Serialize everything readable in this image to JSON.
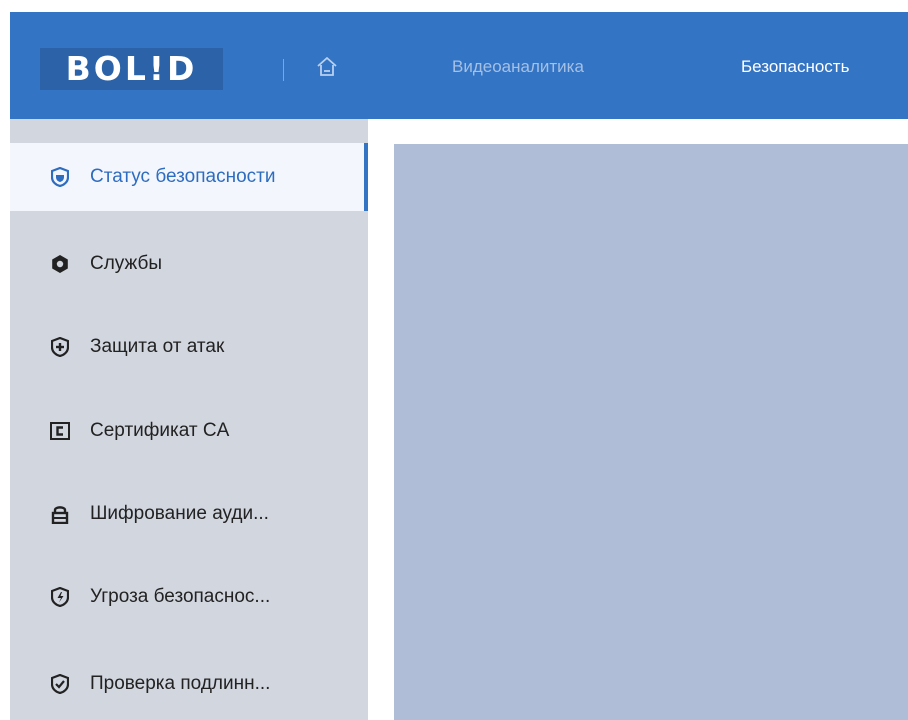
{
  "header": {
    "logo_text": "BOL!D",
    "home_icon": "home-icon",
    "nav": [
      {
        "label": "Видеоаналитика",
        "active": false
      },
      {
        "label": "Безопасность",
        "active": true
      }
    ]
  },
  "sidebar": {
    "items": [
      {
        "label": "Статус безопасности",
        "icon": "shield-icon",
        "active": true
      },
      {
        "label": "Службы",
        "icon": "gear-icon",
        "active": false
      },
      {
        "label": "Защита от атак",
        "icon": "shield-plus-icon",
        "active": false
      },
      {
        "label": "Сертификат CA",
        "icon": "certificate-icon",
        "active": false
      },
      {
        "label": "Шифрование ауди...",
        "icon": "lock-icon",
        "active": false
      },
      {
        "label": "Угроза безопаснос...",
        "icon": "shield-bolt-icon",
        "active": false
      },
      {
        "label": "Проверка подлинн...",
        "icon": "shield-check-icon",
        "active": false
      }
    ]
  },
  "colors": {
    "header_bg": "#3474c4",
    "sidebar_bg": "#d1d6df",
    "active_item_bg": "#f3f7fd",
    "active_accent": "#3474c4",
    "content_bg": "#afbed6"
  }
}
